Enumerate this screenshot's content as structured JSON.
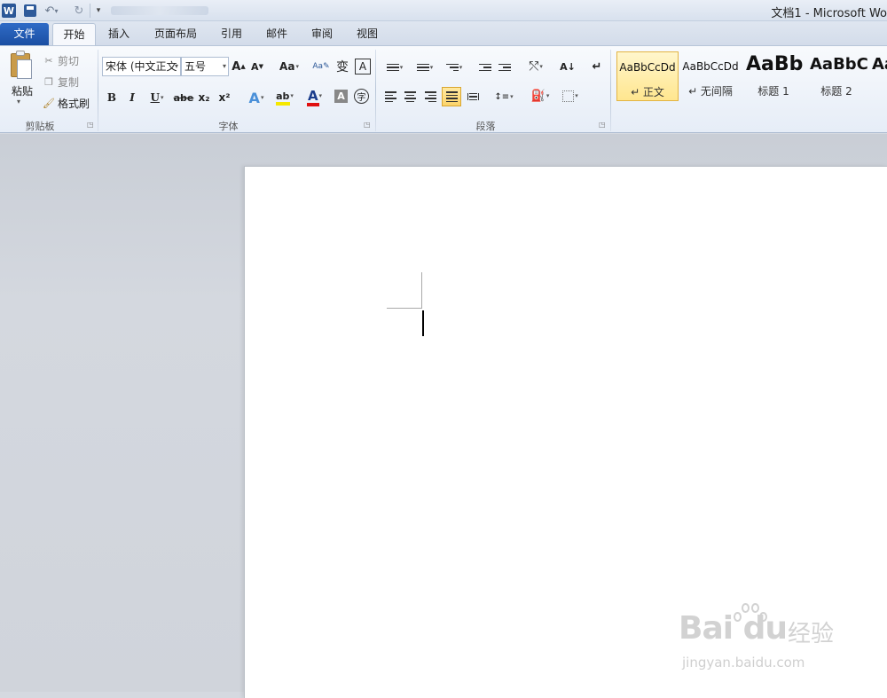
{
  "app": {
    "window_title": "文档1 - Microsoft Wo",
    "app_icon_letter": "W"
  },
  "tabs": [
    {
      "label": "文件"
    },
    {
      "label": "开始"
    },
    {
      "label": "插入"
    },
    {
      "label": "页面布局"
    },
    {
      "label": "引用"
    },
    {
      "label": "邮件"
    },
    {
      "label": "审阅"
    },
    {
      "label": "视图"
    }
  ],
  "clipboard": {
    "paste": "粘贴",
    "cut": "剪切",
    "copy": "复制",
    "format_painter": "格式刷",
    "group": "剪贴板"
  },
  "font": {
    "family": "宋体 (中文正文",
    "size": "五号",
    "grow_label": "A",
    "shrink_label": "A",
    "case_label": "Aa",
    "phonetic_label": "变",
    "border_char_label": "A",
    "bold": "B",
    "italic": "I",
    "underline": "U",
    "strike": "abe",
    "subscript": "x₂",
    "superscript": "x²",
    "effects": "A",
    "highlight": "ab",
    "color": "A",
    "shading": "A",
    "enclose": "字",
    "group": "字体"
  },
  "paragraph": {
    "group": "段落",
    "sort": "A↓",
    "show_marks": "↵"
  },
  "styles": [
    {
      "sample": "AaBbCcDd",
      "name": "↵ 正文",
      "selected": true
    },
    {
      "sample": "AaBbCcDd",
      "name": "↵ 无间隔",
      "selected": false
    },
    {
      "sample": "AaBb",
      "name": "标题 1",
      "selected": false
    },
    {
      "sample": "AaBbC",
      "name": "标题 2",
      "selected": false
    },
    {
      "sample": "Aa",
      "name": "",
      "selected": false
    }
  ],
  "watermark": {
    "logo": "Bai du",
    "jingyan": "经验",
    "url": "jingyan.baidu.com"
  },
  "colors": {
    "file_tab": "#1b4fa3",
    "selected_style": "#ffe68f",
    "font_color_bar": "#e01010",
    "highlight_bar": "#f5e800"
  }
}
